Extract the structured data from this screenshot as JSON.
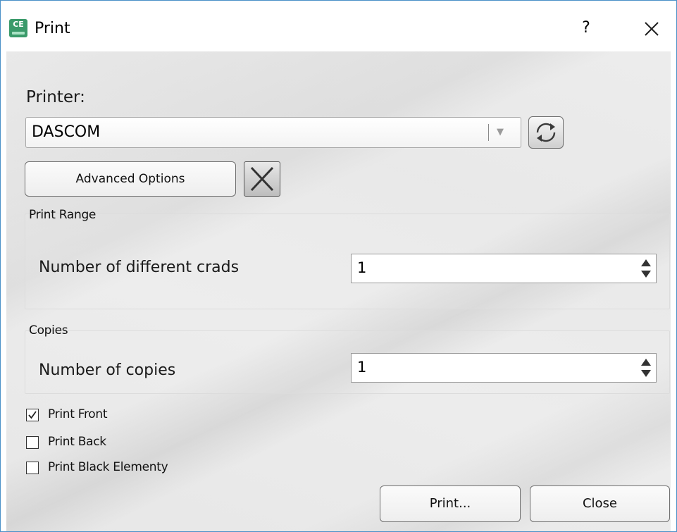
{
  "window": {
    "title": "Print",
    "app_icon_text": "CE",
    "help_label": "?",
    "close_glyph": "close-icon"
  },
  "printer": {
    "label": "Printer:",
    "selected": "DASCOM",
    "refresh_icon": "refresh-icon",
    "advanced_label": "Advanced Options",
    "clear_icon": "x-icon"
  },
  "print_range": {
    "title": "Print Range",
    "field_label": "Number of different crads",
    "value": "1"
  },
  "copies": {
    "title": "Copies",
    "field_label": "Number of copies",
    "value": "1"
  },
  "options": [
    {
      "label": "Print Front",
      "checked": true
    },
    {
      "label": "Print Back",
      "checked": false
    },
    {
      "label": "Print Black Elementy",
      "checked": false
    }
  ],
  "actions": {
    "print_label": "Print...",
    "close_label": "Close"
  },
  "colors": {
    "window_border": "#4a90c8",
    "app_icon": "#3a9a6a"
  }
}
